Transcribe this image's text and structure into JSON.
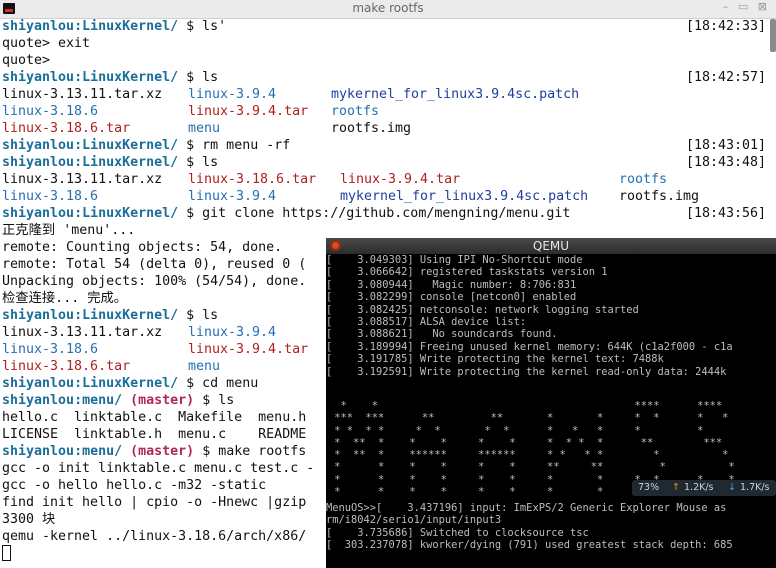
{
  "window": {
    "title": "make rootfs",
    "controls": "– ▭ ⊠"
  },
  "user": "shiyanlou",
  "paths": {
    "kernel": ":LinuxKernel/",
    "menu": ":menu/"
  },
  "branch": "(master)",
  "prompt_sign": "$",
  "lines": {
    "l1_cmd": "$ ls'",
    "l1_ts": "[18:42:33]",
    "l2": "quote> exit",
    "l3": "quote>",
    "l4_cmd": "$ ls",
    "l4_ts": "[18:42:57]",
    "l5": [
      "linux-3.13.11.tar.xz",
      "linux-3.9.4",
      "mykernel_for_linux3.9.4sc.patch"
    ],
    "l6": [
      "linux-3.18.6",
      "linux-3.9.4.tar",
      "rootfs"
    ],
    "l7": [
      "linux-3.18.6.tar",
      "menu",
      "rootfs.img"
    ],
    "l8_cmd": "$ rm menu -rf",
    "l8_ts": "[18:43:01]",
    "l9_cmd": "$ ls",
    "l9_ts": "[18:43:48]",
    "l10": [
      "linux-3.13.11.tar.xz",
      "linux-3.18.6.tar",
      "linux-3.9.4.tar",
      "rootfs"
    ],
    "l11": [
      "linux-3.18.6",
      "linux-3.9.4",
      "mykernel_for_linux3.9.4sc.patch",
      "rootfs.img"
    ],
    "l12_cmd": "$ git clone https://github.com/mengning/menu.git",
    "l12_ts": "[18:43:56]",
    "l13": "正克隆到 'menu'...",
    "l14": "remote: Counting objects: 54, done.",
    "l15": "remote: Total 54 (delta 0), reused 0 (",
    "l16": "Unpacking objects: 100% (54/54), done.",
    "l17": "检查连接... 完成。",
    "l18_cmd": "$ ls",
    "l19": [
      "linux-3.13.11.tar.xz",
      "linux-3.9.4"
    ],
    "l20": [
      "linux-3.18.6",
      "linux-3.9.4.tar"
    ],
    "l21": [
      "linux-3.18.6.tar",
      "menu"
    ],
    "l22_cmd": "$ cd menu",
    "l23_cmd": "$ ls",
    "l24": "hello.c  linktable.c  Makefile  menu.h",
    "l25": "LICENSE  linktable.h  menu.c    README",
    "l26_cmd": "$ make rootfs",
    "l27": "gcc -o init linktable.c menu.c test.c -",
    "l28": "gcc -o hello hello.c -m32 -static",
    "l29": "find init hello | cpio -o -Hnewc |gzip",
    "l30": "3300 块",
    "l31": "qemu -kernel ../linux-3.18.6/arch/x86/"
  },
  "qemu": {
    "title": "QEMU",
    "boot_lines": [
      "[    3.049303] Using IPI No-Shortcut mode",
      "[    3.066642] registered taskstats version 1",
      "[    3.080944]   Magic number: 8:706:831",
      "[    3.082299] console [netcon0] enabled",
      "[    3.082425] netconsole: network logging started",
      "[    3.088517] ALSA device list:",
      "[    3.088621]   No soundcards found.",
      "[    3.189994] Freeing unused kernel memory: 644K (c1a2f000 - c1a",
      "[    3.191785] Write protecting the kernel text: 7488k",
      "[    3.192591] Write protecting the kernel read-only data: 2444k"
    ],
    "art": [
      "  *    *                                         ****      ****",
      " ***  ***      **         **       *       *     *  *      *   *",
      " * *  * *     *  *       *  *      *   *   *     *         *",
      " *  **  *    *    *     *    *     *  * *  *      **        ***",
      " *  **  *    ******     ******     * *   * *        *          *",
      " *      *    *    *     *    *     **     **         *          *",
      " *      *    *    *     *    *     *       *     *  *      *    *",
      " *      *    *    *     *    *     *       *      **        ***"
    ],
    "tail_lines": [
      "MenuOS>>[    3.437196] input: ImExPS/2 Generic Explorer Mouse as",
      "rm/i8042/serio1/input/input3",
      "[    3.735686] Switched to clocksource tsc",
      "[  303.237078] kworker/dying (791) used greatest stack depth: 685"
    ],
    "net_widget": {
      "cpu": "73%",
      "up_arrow": "↑",
      "up": "1.2K/s",
      "down_arrow": "↓",
      "down": "1.7K/s"
    }
  }
}
